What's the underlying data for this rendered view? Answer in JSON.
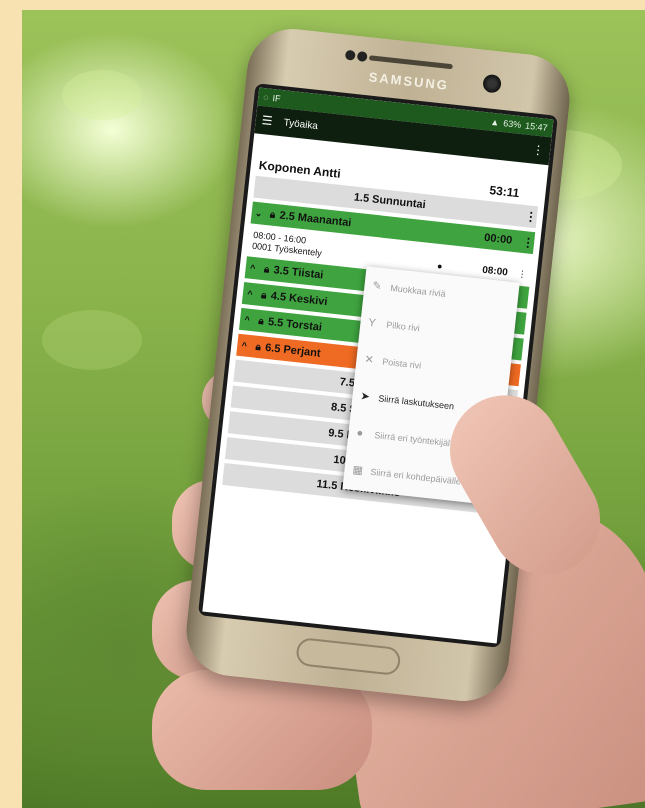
{
  "phone": {
    "brand": "SAMSUNG"
  },
  "status_bar": {
    "left": "IF",
    "right": "63%",
    "time": "15:47"
  },
  "app_bar": {
    "title": "Työaika"
  },
  "employee": {
    "name": "Koponen Antti",
    "total": "53:11"
  },
  "days": [
    {
      "label": "1.5 Sunnuntai",
      "color": "gray"
    },
    {
      "label": "2.5 Maanantai",
      "color": "green",
      "time": "00:00"
    },
    {
      "label": "3.5 Tiistai",
      "color": "green"
    },
    {
      "label": "4.5 Keskivi",
      "color": "green"
    },
    {
      "label": "5.5 Torstai",
      "color": "green"
    },
    {
      "label": "6.5 Perjant",
      "color": "orange"
    },
    {
      "label": "7.5 Lauanta",
      "color": "gray"
    },
    {
      "label": "8.5 Sunnuntai",
      "color": "gray"
    },
    {
      "label": "9.5 Maanantai",
      "color": "gray"
    },
    {
      "label": "10.5 Tiistai",
      "color": "gray"
    },
    {
      "label": "11.5 Keskiviikko",
      "color": "gray"
    }
  ],
  "detail": {
    "range": "08:00 - 16:00",
    "description": "0001 Työskentely",
    "time": "08:00"
  },
  "context_menu": [
    {
      "label": "Muokkaa riviä",
      "icon": "pencil-icon",
      "enabled": false
    },
    {
      "label": "Pilko rivi",
      "icon": "split-icon",
      "enabled": false
    },
    {
      "label": "Poista rivi",
      "icon": "close-icon",
      "enabled": false
    },
    {
      "label": "Siirrä laskutukseen",
      "icon": "send-icon",
      "enabled": true
    },
    {
      "label": "Siirrä eri työntekijälle",
      "icon": "person-icon",
      "enabled": false
    },
    {
      "label": "Siirrä eri kohdepäivälle",
      "icon": "calendar-icon",
      "enabled": false
    }
  ],
  "colors": {
    "frame": "#f8e2b1",
    "green": "#3fa43f",
    "orange": "#ef6a22",
    "gray": "#dcdcdc",
    "statusbar": "#1e5a1e"
  }
}
